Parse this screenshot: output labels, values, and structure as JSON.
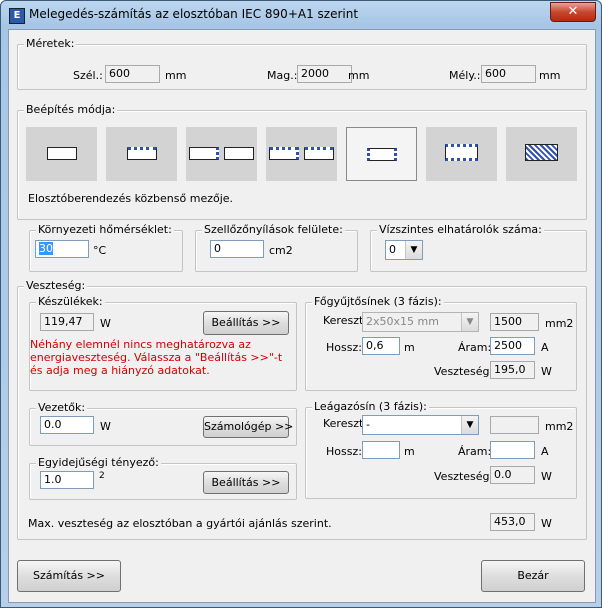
{
  "window": {
    "title": "Melegedés-számítás az elosztóban IEC 890+A1 szerint",
    "close": "✕"
  },
  "meretek": {
    "title": "Méretek:",
    "szel_label": "Szél.:",
    "szel_value": "600",
    "mag_label": "Mag.:",
    "mag_value": "2000",
    "mely_label": "Mély.:",
    "mely_value": "600",
    "unit": "mm"
  },
  "beepites": {
    "title": "Beépítés módja:",
    "description": "Elosztóberendezés közbenső mezője.",
    "selected_index": 4
  },
  "kornyezeti": {
    "title": "Környezeti hőmérséklet:",
    "value": "30",
    "unit": "°C"
  },
  "szellozo": {
    "title": "Szellőzőnyílások felülete:",
    "value": "0",
    "unit": "cm2"
  },
  "vizszintes": {
    "title": "Vízszintes elhatárolók száma:",
    "value": "0"
  },
  "veszteseg": {
    "title": "Veszteség:",
    "keszulekek": {
      "title": "Készülékek:",
      "value": "119,47",
      "unit": "W",
      "button": "Beállítás >>",
      "warning": "Néhány elemnél nincs meghatározva az energiaveszteség. Válassza a \"Beállítás >>\"-t és adja meg a hiányzó adatokat."
    },
    "vezetok": {
      "title": "Vezetők:",
      "value": "0.0",
      "unit": "W",
      "button": "Számológép >>"
    },
    "egyideju": {
      "title": "Egyidejűségi tényező:",
      "value": "1.0",
      "exponent": "2",
      "button": "Beállítás >>"
    },
    "fogyujto": {
      "title": "Főgyűjtősínek (3 fázis):",
      "kereszt_label": "Kereszt",
      "kereszt_value": "2x50x15 mm",
      "kereszt_mm2": "1500",
      "mm2_unit": "mm2",
      "hossz_label": "Hossz:",
      "hossz_value": "0,6",
      "hossz_unit": "m",
      "aram_label": "Áram:",
      "aram_value": "2500",
      "aram_unit": "A",
      "veszteseg_label": "Veszteség:",
      "veszteseg_value": "195,0",
      "veszteseg_unit": "W"
    },
    "leagazo": {
      "title": "Leágazósín (3 fázis):",
      "kereszt_label": "Kereszt",
      "kereszt_value": "-",
      "kereszt_mm2": "",
      "mm2_unit": "mm2",
      "hossz_label": "Hossz:",
      "hossz_value": "",
      "hossz_unit": "m",
      "aram_label": "Áram:",
      "aram_value": "",
      "aram_unit": "A",
      "veszteseg_label": "Veszteség:",
      "veszteseg_value": "0.0",
      "veszteseg_unit": "W"
    },
    "max_label": "Max. veszteség az elosztóban a gyártói ajánlás szerint.",
    "max_value": "453,0",
    "max_unit": "W"
  },
  "buttons": {
    "szamitas": "Számítás >>",
    "bezar": "Bezár"
  }
}
